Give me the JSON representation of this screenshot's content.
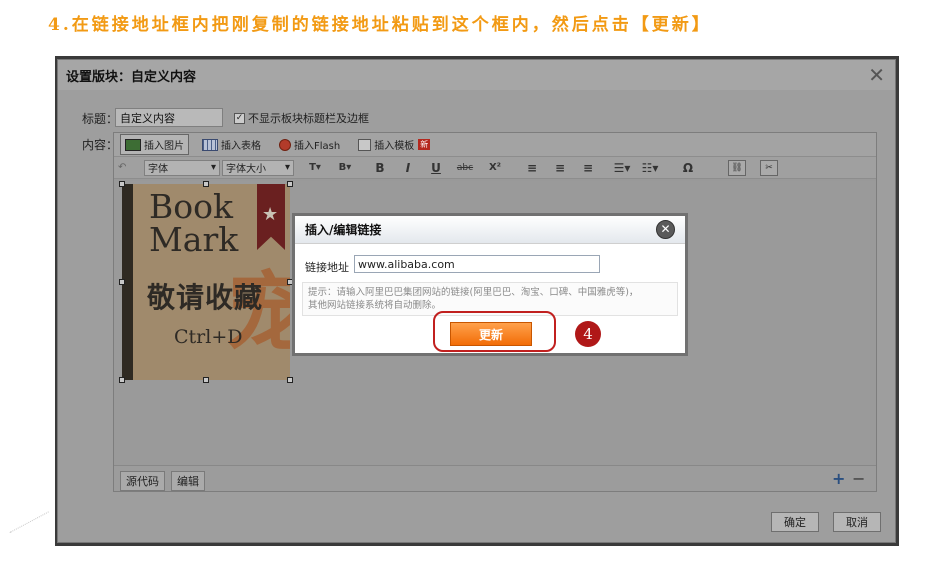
{
  "instruction": "4.在链接地址框内把刚复制的链接地址粘贴到这个框内，然后点击【更新】",
  "dialog": {
    "title": "设置版块：自定义内容",
    "close_icon": "close-icon",
    "title_label": "标题：",
    "title_value": "自定义内容",
    "hide_title_bar_label": "不显示板块标题栏及边框",
    "hide_title_bar_checked": true,
    "content_label": "内容："
  },
  "toolbar": {
    "insert_image": "插入图片",
    "insert_table": "插入表格",
    "insert_flash": "插入Flash",
    "insert_template": "插入模板",
    "template_badge": "新"
  },
  "format_bar": {
    "undo": "↶",
    "font": "字体",
    "font_size": "字体大小",
    "text_color": "T",
    "bg_color": "B",
    "bold": "B",
    "italic": "I",
    "underline": "U",
    "strike": "abc",
    "superscript": "X²",
    "omega": "Ω"
  },
  "bookmark_image": {
    "line1": "Book",
    "line2": "Mark",
    "chinese": "敬请收藏",
    "shortcut": "Ctrl+D",
    "watermark": "宠"
  },
  "editor_tabs": {
    "source": "源代码",
    "edit": "编辑"
  },
  "footer": {
    "confirm": "确定",
    "cancel": "取消"
  },
  "link_dialog": {
    "title": "插入/编辑链接",
    "url_label": "链接地址",
    "url_value": "www.alibaba.com",
    "hint_line1": "提示：请输入阿里巴巴集团网站的链接(阿里巴巴、淘宝、口碑、中国雅虎等)，",
    "hint_line2": "其他网站链接系统将自动删除。",
    "update_button": "更新"
  },
  "step_marker": "4",
  "colors": {
    "instruction": "#f29a14",
    "highlight": "#c1201f",
    "update_button": "#f26d07"
  }
}
